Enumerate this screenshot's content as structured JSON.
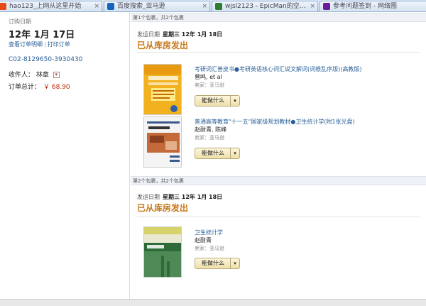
{
  "browser": {
    "tabs": [
      {
        "label": "hao123_上网从这里开始",
        "icon_color": "#e64a19"
      },
      {
        "label": "百度搜索_亚马逊",
        "icon_color": "#1565c0"
      },
      {
        "label": "wjsl2123 - EpicMan的空...",
        "icon_color": "#2e7d32"
      },
      {
        "label": "参考问题签到 - 网络图",
        "icon_color": "#6a1b9a"
      }
    ]
  },
  "order": {
    "date_label": "订购日期",
    "date": "12年 1月 17日",
    "view_details_link": "查看订单明细",
    "link_separator": "|",
    "print_invoice_link": "打印订单",
    "order_number": "C02-8129650-3930430",
    "recipient_label": "收件人：",
    "recipient_name": "林章",
    "dropdown_glyph": "▾",
    "total_label": "订单总计：",
    "total_amount": "￥ 68.90"
  },
  "packages": [
    {
      "header": "第1个包裹，共2个包裹",
      "ship_date_label": "发运日期",
      "ship_date": "星期三  12年 1月 18日",
      "status": "已从库房发出",
      "items": [
        {
          "title": "考研词汇普皮书●考研英语核心词汇说文解词(词根乱序版)(高教版)",
          "author": "曾鸣, et al",
          "seller": "卖家：亚马逊",
          "button_label": "能做什么",
          "cover_style": "yellow"
        },
        {
          "title": "普通高等教育\"十一五\"国家级规划教材●卫生统计学(附1张光盘)",
          "author": "赵耐青, 陈峰",
          "seller": "卖家：亚马逊",
          "button_label": "能做什么",
          "cover_style": "white"
        }
      ]
    },
    {
      "header": "第2个包裹，共2个包裹",
      "ship_date_label": "发运日期",
      "ship_date": "星期三  12年 1月 18日",
      "status": "已从库房发出",
      "items": [
        {
          "title": "卫生统计学",
          "author": "赵耐青",
          "seller": "卖家：亚马逊",
          "button_label": "能做什么",
          "cover_style": "green"
        }
      ]
    }
  ],
  "icons": {
    "button_caret": "▾",
    "tab_close": "×"
  },
  "colors": {
    "status": "#c7781a",
    "link": "#2a6099",
    "price": "#b12704"
  }
}
